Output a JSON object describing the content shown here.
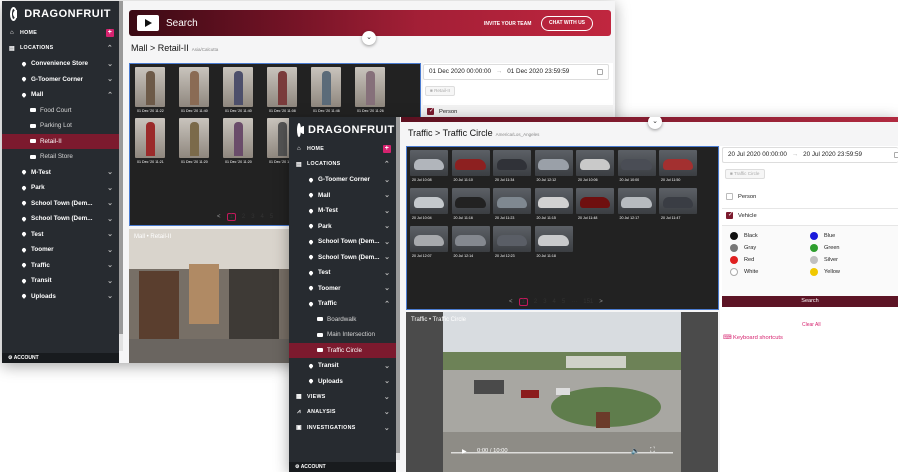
{
  "brand": {
    "name": "DRAGONFRUIT"
  },
  "window1": {
    "header": {
      "title": "Search",
      "invite": "INVITE YOUR TEAM",
      "chat": "CHAT WITH US"
    },
    "breadcrumb": {
      "path": "Mall > Retail-II",
      "timezone": "Asia/Calcutta"
    },
    "nav": [
      {
        "label": "HOME",
        "kind": "top",
        "icon": "home-icon",
        "badge": "+"
      },
      {
        "label": "LOCATIONS",
        "kind": "top",
        "icon": "locations-icon",
        "chevron": "^"
      },
      {
        "label": "Convenience Store",
        "kind": "loc",
        "chevron": "v"
      },
      {
        "label": "G-Toomer Corner",
        "kind": "loc",
        "chevron": "v"
      },
      {
        "label": "Mall",
        "kind": "loc",
        "chevron": "^"
      },
      {
        "label": "Food Court",
        "kind": "cam"
      },
      {
        "label": "Parking Lot",
        "kind": "cam"
      },
      {
        "label": "Retail-II",
        "kind": "cam",
        "active": true
      },
      {
        "label": "Retail Store",
        "kind": "cam"
      },
      {
        "label": "M-Test",
        "kind": "loc",
        "chevron": "v"
      },
      {
        "label": "Park",
        "kind": "loc",
        "chevron": "v"
      },
      {
        "label": "School Town (Dem...",
        "kind": "loc",
        "chevron": "v"
      },
      {
        "label": "School Town (Dem...",
        "kind": "loc",
        "chevron": "v"
      },
      {
        "label": "Test",
        "kind": "loc",
        "chevron": "v"
      },
      {
        "label": "Toomer",
        "kind": "loc",
        "chevron": "v"
      },
      {
        "label": "Traffic",
        "kind": "loc",
        "chevron": "v"
      },
      {
        "label": "Transit",
        "kind": "loc",
        "chevron": "v"
      },
      {
        "label": "Uploads",
        "kind": "loc",
        "chevron": "v"
      }
    ],
    "account": "ACCOUNT",
    "results": {
      "captions": [
        "01 Dec '20 11:22",
        "01 Dec '20 11:40",
        "01 Dec '20 11:40",
        "01 Dec '20 11:08",
        "01 Dec '20 11:46",
        "01 Dec '20 11:26",
        "01 Dec '20 11:21",
        "01 Dec '20 11:20",
        "01 Dec '20 11:20",
        "01 Dec '20 11:"
      ],
      "pages": [
        "<",
        "1",
        "2",
        "3",
        "4",
        "5"
      ]
    },
    "video": {
      "label": "Mall • Retail-II"
    },
    "filters": {
      "date_from": "01 Dec 2020 00:00:00",
      "date_to": "01 Dec 2020 23:59:59",
      "arrow": "→",
      "camera_chip": "Retail-II",
      "object": "Person"
    }
  },
  "window2": {
    "breadcrumb": {
      "path": "Traffic > Traffic Circle",
      "timezone": "America/Los_Angeles"
    },
    "nav": [
      {
        "label": "HOME",
        "kind": "top",
        "icon": "home-icon",
        "badge": "+"
      },
      {
        "label": "LOCATIONS",
        "kind": "top",
        "icon": "locations-icon",
        "chevron": "^"
      },
      {
        "label": "G-Toomer Corner",
        "kind": "loc",
        "chevron": "v"
      },
      {
        "label": "Mall",
        "kind": "loc",
        "chevron": "v"
      },
      {
        "label": "M-Test",
        "kind": "loc",
        "chevron": "v"
      },
      {
        "label": "Park",
        "kind": "loc",
        "chevron": "v"
      },
      {
        "label": "School Town (Dem...",
        "kind": "loc",
        "chevron": "v"
      },
      {
        "label": "School Town (Dem...",
        "kind": "loc",
        "chevron": "v"
      },
      {
        "label": "Test",
        "kind": "loc",
        "chevron": "v"
      },
      {
        "label": "Toomer",
        "kind": "loc",
        "chevron": "v"
      },
      {
        "label": "Traffic",
        "kind": "loc",
        "chevron": "^"
      },
      {
        "label": "Boardwalk",
        "kind": "cam"
      },
      {
        "label": "Main Intersection",
        "kind": "cam"
      },
      {
        "label": "Traffic Circle",
        "kind": "cam",
        "active": true
      },
      {
        "label": "Transit",
        "kind": "loc",
        "chevron": "v"
      },
      {
        "label": "Uploads",
        "kind": "loc",
        "chevron": "v"
      },
      {
        "label": "VIEWS",
        "kind": "top",
        "icon": "views-icon",
        "chevron": "v"
      },
      {
        "label": "ANALYSIS",
        "kind": "top",
        "icon": "analysis-icon",
        "chevron": "v"
      },
      {
        "label": "INVESTIGATIONS",
        "kind": "top",
        "icon": "investigations-icon",
        "chevron": "v"
      }
    ],
    "account": "ACCOUNT",
    "results": {
      "captions": [
        "20 Jul 10:08",
        "20 Jul 11:10",
        "20 Jul 11:34",
        "20 Jul 12:12",
        "20 Jul 10:06",
        "20 Jul 10:00",
        "20 Jul 11:50",
        "20 Jul 10:04",
        "20 Jul 11:16",
        "20 Jul 11:23",
        "20 Jul 11:15",
        "20 Jul 11:48",
        "20 Jul 12:17",
        "20 Jul 11:47",
        "20 Jul 12:07",
        "20 Jul 12:14",
        "20 Jul 12:23",
        "20 Jul 11:18"
      ],
      "pages": [
        "<",
        "1",
        "2",
        "3",
        "4",
        "5",
        "···",
        "151",
        ">"
      ]
    },
    "video": {
      "label": "Traffic • Traffic Circle",
      "time": "0:00 / 10:00"
    },
    "filters": {
      "date_from": "20 Jul 2020 00:00:00",
      "date_to": "20 Jul 2020 23:59:59",
      "arrow": "→",
      "camera_chip": "Traffic Circle",
      "objects": [
        {
          "label": "Person",
          "checked": false
        },
        {
          "label": "Vehicle",
          "checked": true
        }
      ],
      "colors": [
        {
          "label": "Black",
          "hex": "#111111"
        },
        {
          "label": "Blue",
          "hex": "#1a1adb"
        },
        {
          "label": "Gray",
          "hex": "#777777"
        },
        {
          "label": "Green",
          "hex": "#2e9e2e"
        },
        {
          "label": "Red",
          "hex": "#e02020"
        },
        {
          "label": "Silver",
          "hex": "#c0c0c0"
        },
        {
          "label": "White",
          "hex": "#ffffff"
        },
        {
          "label": "Yellow",
          "hex": "#f0c800"
        }
      ],
      "search": "Search",
      "clear": "Clear All",
      "shortcuts": "Keyboard shortcuts"
    }
  },
  "theme": {
    "accent": "#7c1a2e",
    "sidebar": "#272b30",
    "link": "#d6236f",
    "selection": "#4a7bd0"
  }
}
